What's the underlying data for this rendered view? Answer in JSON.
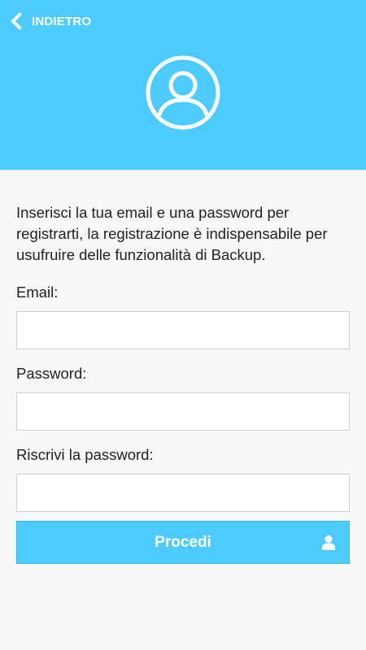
{
  "header": {
    "back_label": "INDIETRO",
    "back_icon": "chevron-left-icon",
    "avatar_icon": "user-circle-icon",
    "background_color": "#4dcbfe"
  },
  "form": {
    "intro_text": "Inserisci la tua email e una password per registrarti, la registrazione è indispensabile per usufruire delle funzionalità di Backup.",
    "email_label": "Email:",
    "email_value": "",
    "password_label": "Password:",
    "password_value": "",
    "repeat_password_label": "Riscrivi la password:",
    "repeat_password_value": "",
    "submit_label": "Procedi",
    "submit_icon": "user-icon"
  }
}
